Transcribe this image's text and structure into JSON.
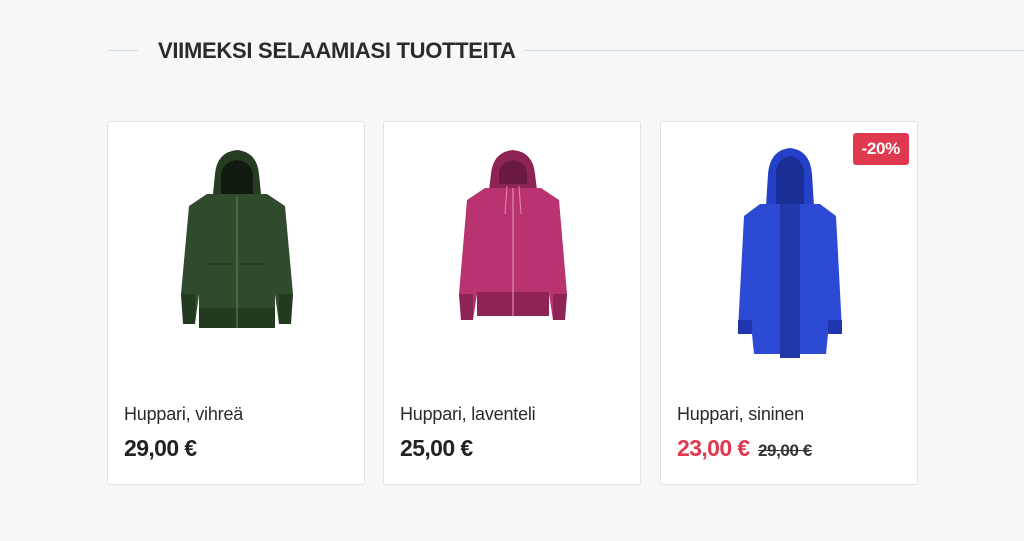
{
  "section": {
    "title": "VIIMEKSI SELAAMIASI TUOTTEITA"
  },
  "products": [
    {
      "name": "Huppari, vihreä",
      "price": "29,00 €",
      "image_icon": "green-hoodie-image",
      "color": "#2f4a2c"
    },
    {
      "name": "Huppari, laventeli",
      "price": "25,00 €",
      "image_icon": "lavender-hoodie-image",
      "color": "#b8336f"
    },
    {
      "name": "Huppari, sininen",
      "price": "23,00 €",
      "old_price": "29,00 €",
      "badge": "-20%",
      "image_icon": "blue-hoodie-image",
      "color": "#2440c8"
    }
  ],
  "colors": {
    "sale": "#e0394f",
    "background": "#f6f7f8"
  }
}
